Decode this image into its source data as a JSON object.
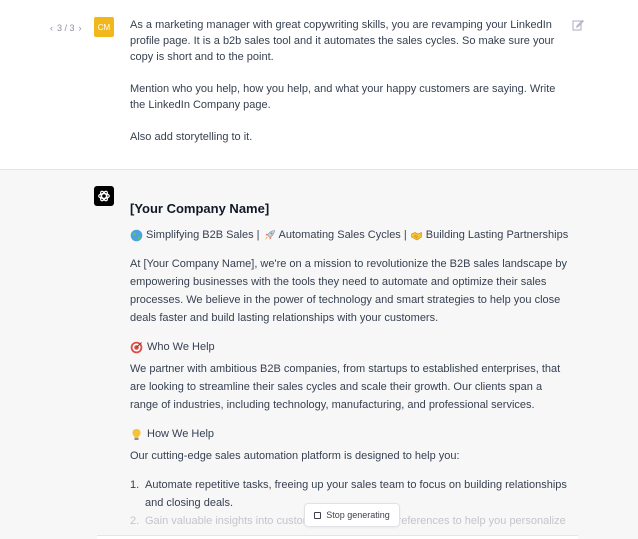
{
  "pager": {
    "prev": "‹",
    "label": "3 / 3",
    "next": "›"
  },
  "user": {
    "avatar_initials": "CM",
    "avatar_color": "#f2b81b",
    "paragraphs": [
      "As a marketing manager with great copywriting skills, you are revamping your LinkedIn profile page. It is a b2b sales tool and it automates the sales cycles. So make sure your copy is short and to the point.",
      "Mention who you help, how you help, and what your happy customers are saying. Write the LinkedIn Company page.",
      "Also add storytelling to it."
    ]
  },
  "assistant": {
    "title": "[Your Company Name]",
    "tagline": [
      {
        "icon": "globe",
        "text": "Simplifying B2B Sales |"
      },
      {
        "icon": "rocket",
        "text": "Automating Sales Cycles |"
      },
      {
        "icon": "handshake",
        "text": "Building Lasting Partnerships"
      }
    ],
    "intro": "At [Your Company Name], we're on a mission to revolutionize the B2B sales landscape by empowering businesses with the tools they need to automate and optimize their sales processes. We believe in the power of technology and smart strategies to help you close deals faster and build lasting relationships with your customers.",
    "who": {
      "heading": "Who We Help",
      "icon": "target",
      "body": "We partner with ambitious B2B companies, from startups to established enterprises, that are looking to streamline their sales cycles and scale their growth. Our clients span a range of industries, including technology, manufacturing, and professional services."
    },
    "how": {
      "heading": "How We Help",
      "icon": "lightbulb",
      "body": "Our cutting-edge sales automation platform is designed to help you:",
      "items": [
        {
          "num": "1.",
          "text": "Automate repetitive tasks, freeing up your sales team to focus on building relationships and closing deals."
        },
        {
          "num": "2.",
          "text": "Gain valuable insights into customer behavior and preferences to help you personalize"
        }
      ]
    }
  },
  "stop_button": {
    "label": "Stop generating"
  }
}
